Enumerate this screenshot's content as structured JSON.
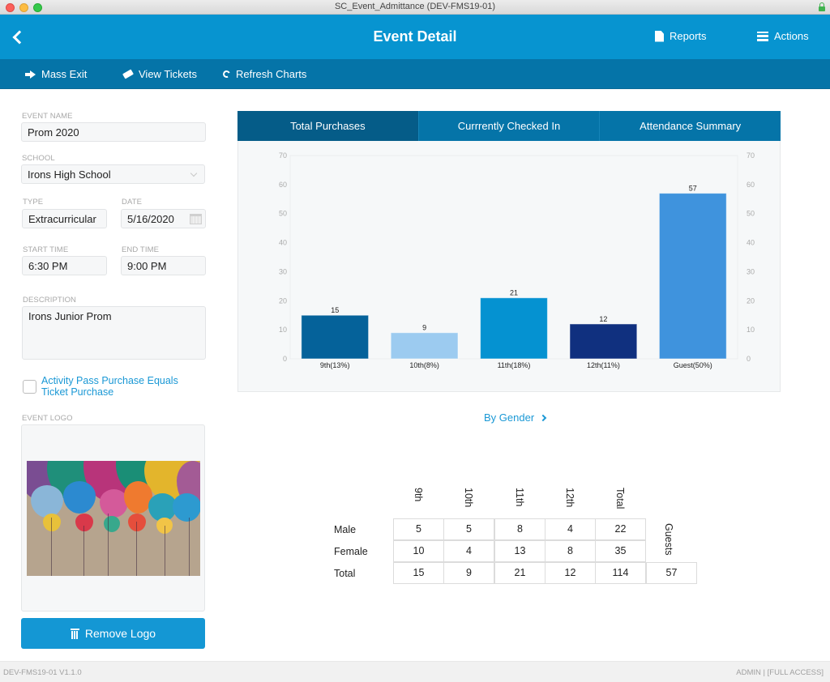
{
  "window": {
    "title": "SC_Event_Admittance (DEV-FMS19-01)"
  },
  "header": {
    "title": "Event Detail",
    "reports_label": "Reports",
    "actions_label": "Actions"
  },
  "toolbar": {
    "mass_exit": "Mass Exit",
    "view_tickets": "View Tickets",
    "refresh_charts": "Refresh Charts"
  },
  "form": {
    "event_name": {
      "label": "EVENT NAME",
      "value": "Prom 2020"
    },
    "school": {
      "label": "SCHOOL",
      "value": "Irons High School"
    },
    "type": {
      "label": "TYPE",
      "value": "Extracurricular"
    },
    "date": {
      "label": "DATE",
      "value": "5/16/2020"
    },
    "start_time": {
      "label": "START TIME",
      "value": "6:30 PM"
    },
    "end_time": {
      "label": "END TIME",
      "value": "9:00 PM"
    },
    "description": {
      "label": "DESCRIPTION",
      "value": "Irons Junior Prom"
    },
    "activity_pass": {
      "label": "Activity Pass Purchase Equals Ticket Purchase",
      "checked": false
    },
    "event_logo": {
      "label": "EVENT LOGO"
    },
    "remove_logo": "Remove Logo"
  },
  "tabs": [
    {
      "label": "Total Purchases",
      "active": true
    },
    {
      "label": "Currrently Checked In",
      "active": false
    },
    {
      "label": "Attendance Summary",
      "active": false
    }
  ],
  "chart_data": {
    "type": "bar",
    "title": "",
    "xlabel": "",
    "ylabel": "",
    "categories": [
      "9th(13%)",
      "10th(8%)",
      "11th(18%)",
      "12th(11%)",
      "Guest(50%)"
    ],
    "values": [
      15,
      9,
      21,
      12,
      57
    ],
    "colors": [
      "#05629a",
      "#9ccbf0",
      "#0592d1",
      "#10307f",
      "#3f93dd"
    ],
    "ylim": [
      0,
      70
    ],
    "yticks": [
      0,
      10,
      20,
      30,
      40,
      50,
      60,
      70
    ],
    "dual_y_axis": true,
    "grid": false,
    "data_labels": true
  },
  "by_gender_link": "By Gender",
  "gender_table": {
    "columns": [
      "9th",
      "10th",
      "11th",
      "12th",
      "Total"
    ],
    "guests_header": "Guests",
    "rows": [
      {
        "label": "Male",
        "values": [
          "5",
          "5",
          "8",
          "4",
          "22"
        ]
      },
      {
        "label": "Female",
        "values": [
          "10",
          "4",
          "13",
          "8",
          "35"
        ]
      },
      {
        "label": "Total",
        "values": [
          "15",
          "9",
          "21",
          "12",
          "114"
        ],
        "guests": "57"
      }
    ]
  },
  "status": {
    "left": "DEV-FMS19-01 V1.1.0",
    "right": "ADMIN | [FULL ACCESS]"
  },
  "colors": {
    "header": "#0794d0",
    "toolbar": "#0574a8",
    "active_tab": "#055c88",
    "link": "#1a98d5",
    "button": "#1497d4"
  }
}
